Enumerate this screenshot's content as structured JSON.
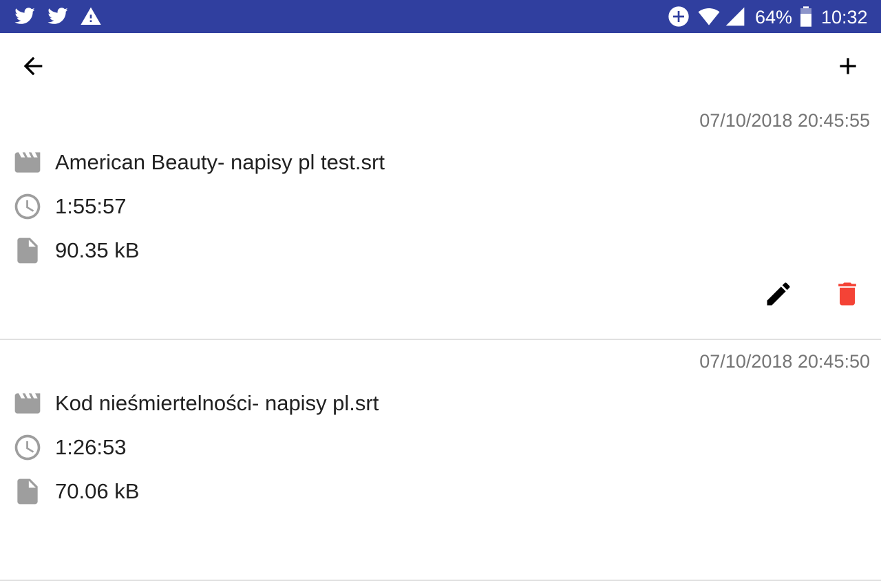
{
  "status_bar": {
    "background": "#303f9f",
    "notification_icons": [
      "twitter-icon",
      "twitter-icon",
      "warning-icon"
    ],
    "system_icons": [
      "data-saver-icon",
      "wifi-icon",
      "cellular-signal-icon",
      "battery-icon"
    ],
    "battery_percent": "64%",
    "time": "10:32"
  },
  "toolbar": {
    "back_icon": "arrow-back-icon",
    "add_icon": "plus-icon"
  },
  "items": [
    {
      "date": "07/10/2018 20:45:55",
      "name": "American Beauty- napisy pl test.srt",
      "duration": "1:55:57",
      "size": "90.35 kB"
    },
    {
      "date": "07/10/2018 20:45:50",
      "name": "Kod nieśmiertelności- napisy pl.srt",
      "duration": "1:26:53",
      "size": "70.06 kB"
    }
  ],
  "colors": {
    "icon_gray": "#9e9e9e",
    "delete_red": "#f44336",
    "date_gray": "#757575"
  }
}
